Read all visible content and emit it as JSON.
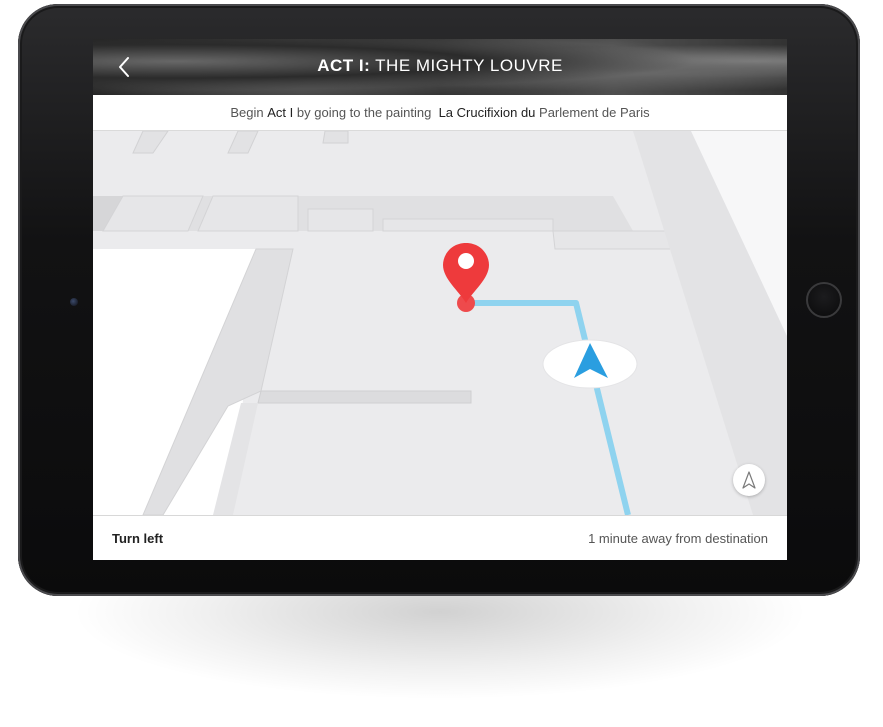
{
  "header": {
    "act_label": "ACT I:",
    "title": "THE MIGHTY LOUVRE",
    "back_icon": "chevron-left-icon"
  },
  "instruction": {
    "prefix": "Begin",
    "act": "Act I",
    "middle": "by going to the painting",
    "painting": "La Crucifixion du",
    "painting_rest": "Parlement de Paris"
  },
  "map": {
    "destination_icon": "map-pin-icon",
    "position_icon": "navigation-arrow-icon",
    "compass_icon": "compass-north-icon",
    "route_color": "#8fd3ef",
    "pin_color": "#ee3a3c",
    "arrow_color": "#2a9ee0"
  },
  "footer": {
    "direction": "Turn left",
    "eta": "1 minute away from destination"
  }
}
